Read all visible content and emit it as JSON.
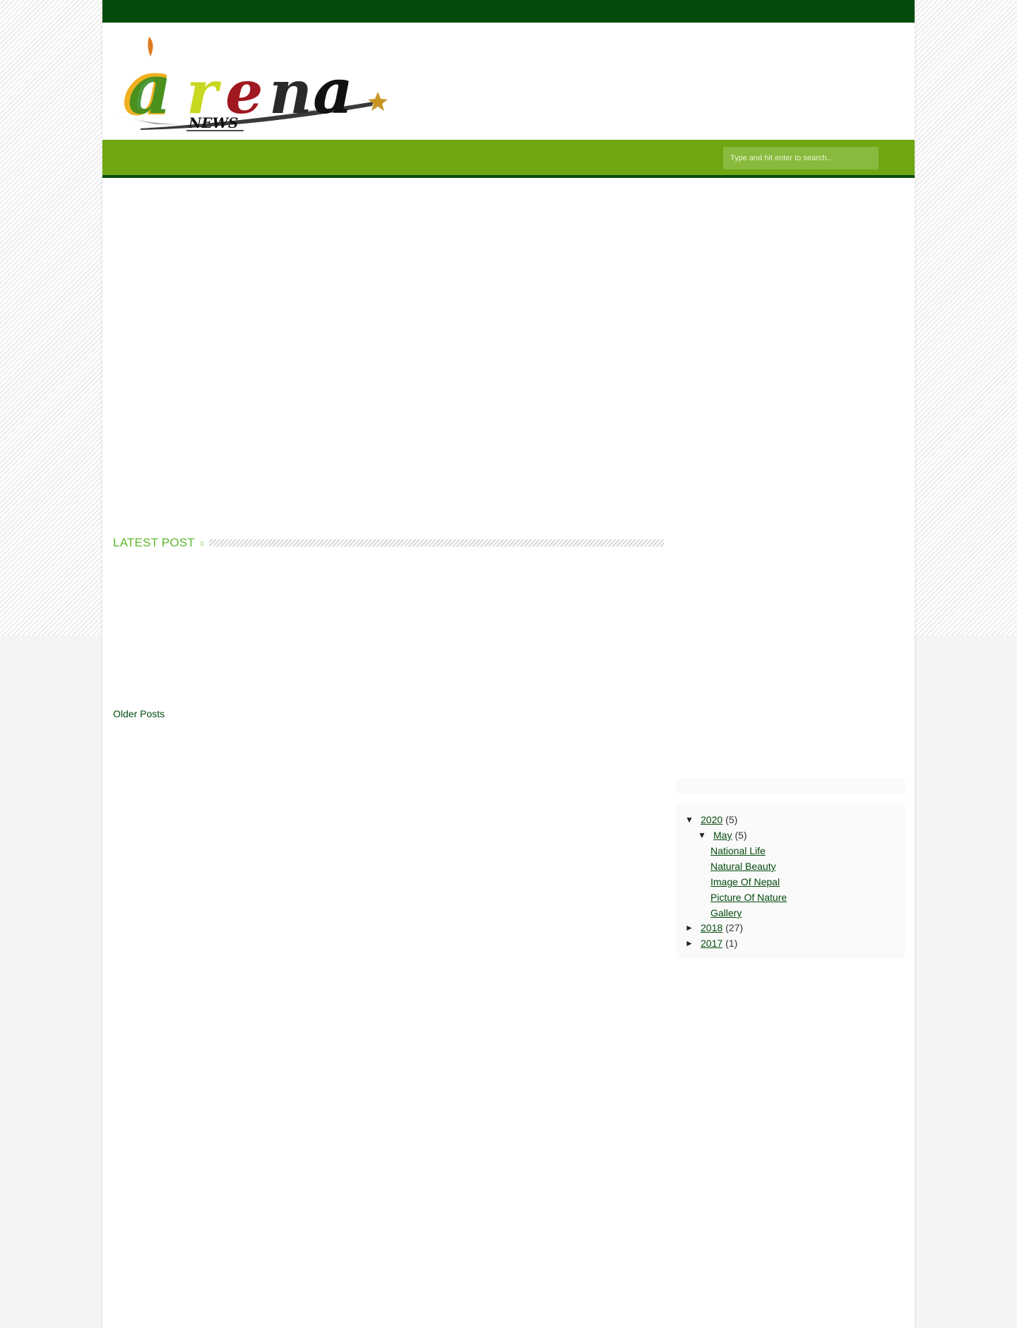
{
  "header": {
    "logo_text": "arena",
    "logo_subtext": "NEWS"
  },
  "search": {
    "placeholder": "Type and hit enter to search..."
  },
  "main": {
    "latest_title": "LATEST POST",
    "latest_icon": "▯",
    "older_posts": "Older Posts"
  },
  "archive": {
    "years": [
      {
        "toggle": "▼",
        "label": "2020",
        "count": "(5)",
        "months": [
          {
            "toggle": "▼",
            "label": "May",
            "count": "(5)",
            "posts": [
              "National Life",
              "Natural Beauty",
              "Image Of Nepal",
              "Picture Of Nature",
              "Gallery"
            ]
          }
        ]
      },
      {
        "toggle": "►",
        "label": "2018",
        "count": "(27)"
      },
      {
        "toggle": "►",
        "label": "2017",
        "count": "(1)"
      }
    ]
  },
  "colors": {
    "topbar": "#044b0c",
    "navbar": "#6fa612",
    "accent": "#5fb82e",
    "link": "#044b0c"
  }
}
